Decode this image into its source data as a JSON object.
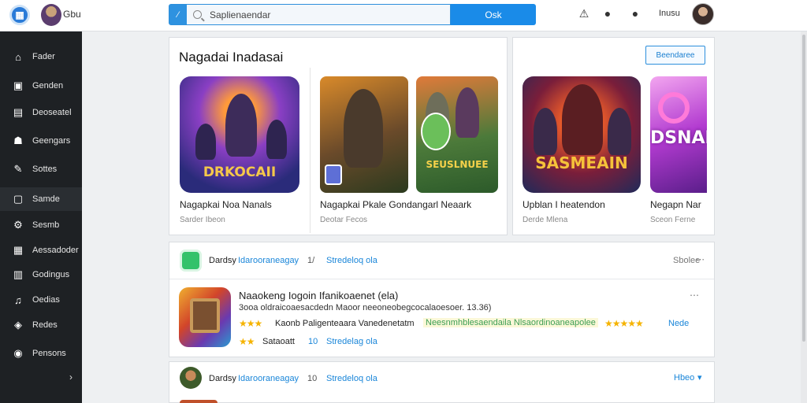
{
  "topbar": {
    "user_name": "Gbu",
    "search_placeholder": "Saplienaendar",
    "search_button": "Osk",
    "right_label": "Inusu"
  },
  "sidebar": {
    "items": [
      {
        "label": "Fader",
        "icon": "home-icon"
      },
      {
        "label": "Genden",
        "icon": "monitor-icon"
      },
      {
        "label": "Deoseatel",
        "icon": "book-icon"
      },
      {
        "label": "Geengars",
        "icon": "gamepad-icon"
      },
      {
        "label": "Sottes",
        "icon": "wrench-icon"
      },
      {
        "label": "Samde",
        "icon": "screen-icon"
      },
      {
        "label": "Sesmb",
        "icon": "gear-icon"
      },
      {
        "label": "Aessadoder",
        "icon": "grid-icon"
      },
      {
        "label": "Godingus",
        "icon": "code-icon"
      },
      {
        "label": "Oedias",
        "icon": "music-icon"
      },
      {
        "label": "Redes",
        "icon": "shield-icon"
      },
      {
        "label": "Pensons",
        "icon": "globe-icon"
      }
    ]
  },
  "featured": {
    "title": "Nagadai Inadasai",
    "see_more": "Beendaree",
    "games": [
      {
        "title": "Nagapkai Noa Nanals",
        "sub": "Sarder Ibeon",
        "art_text": "DRKOCAII"
      },
      {
        "title": "Nagapkai Pkale Gondangarl Neaark",
        "sub": "Deotar Fecos",
        "art_text": "SEUSLNUEE"
      },
      {
        "title": "Upblan I heatendon",
        "sub": "Derde Mlena",
        "art_text": "SASMEAIN"
      },
      {
        "title": "Negapn Nar",
        "sub": "Sceon Ferne",
        "art_text": "DSNAE"
      }
    ]
  },
  "list": {
    "row1": {
      "dev": "Dardsy",
      "link": "Idarooraneagay",
      "count": "1/",
      "more": "Stredeloq ola",
      "right": "Sbolee"
    },
    "app": {
      "title": "Naaokeng Iogoin  Ifanikoaenet (ela)",
      "subtitle": "3ooa oldraicoaesacdedn Maoor neeoneobegcocalaoesoer. 13.36)",
      "tagline_1": "Kaonb  Paligenteaara  Vanedenetatm",
      "tagline_highlight": "Neesnmhblesaendaila Nlsaordinoaneapolee",
      "tagline_2": "Nede",
      "rating_text": "Sataoatt",
      "count": "10",
      "more": "Stredelag ola"
    },
    "row3": {
      "dev": "Dardsy",
      "link": "Idarooraneagay",
      "count": "10",
      "more": "Stredeloq ola",
      "right": "Hbeo"
    }
  }
}
